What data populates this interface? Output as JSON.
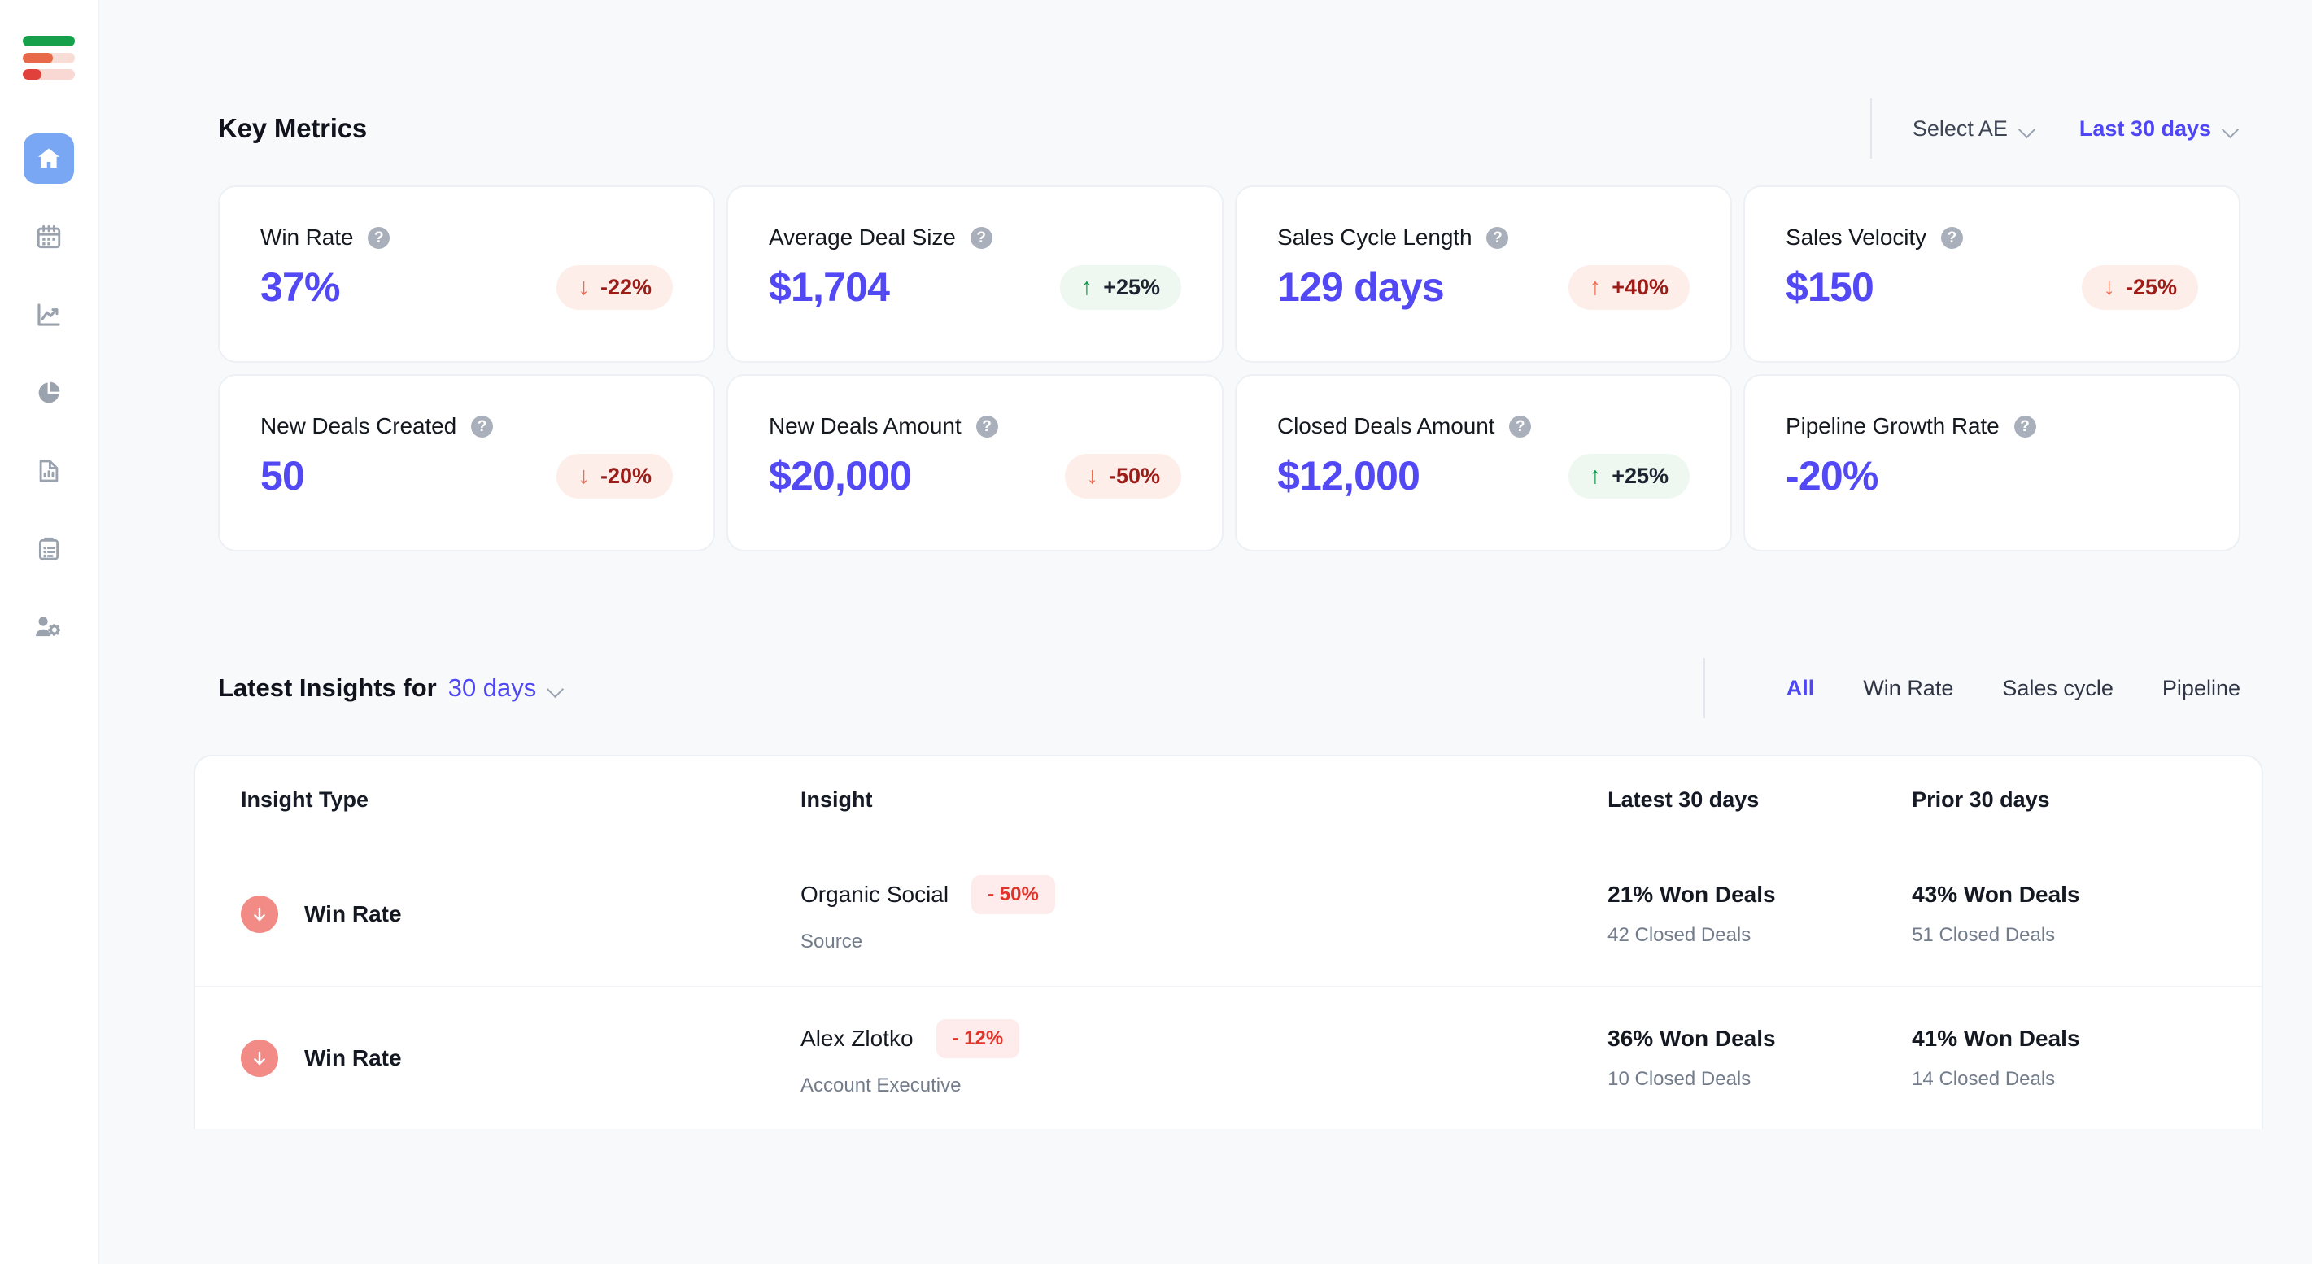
{
  "sidebar": {
    "logo_name": "analytics-logo",
    "items": [
      {
        "icon": "home-icon",
        "label": "Home",
        "active": true
      },
      {
        "icon": "calendar-icon",
        "label": "Calendar",
        "active": false
      },
      {
        "icon": "trending-up-chart-icon",
        "label": "Trends",
        "active": false
      },
      {
        "icon": "pie-chart-icon",
        "label": "Reports",
        "active": false
      },
      {
        "icon": "document-chart-icon",
        "label": "Documents",
        "active": false
      },
      {
        "icon": "clipboard-list-icon",
        "label": "Tasks",
        "active": false
      },
      {
        "icon": "user-settings-icon",
        "label": "Team Settings",
        "active": false
      }
    ]
  },
  "header": {
    "title": "Key Metrics",
    "ae_filter": "Select AE",
    "date_filter": "Last 30 days"
  },
  "metrics": [
    {
      "label": "Win Rate",
      "value": "37%",
      "trend": "-22%",
      "direction": "down",
      "tone": "bad"
    },
    {
      "label": "Average Deal Size",
      "value": "$1,704",
      "trend": "+25%",
      "direction": "up",
      "tone": "good"
    },
    {
      "label": "Sales Cycle Length",
      "value": "129 days",
      "trend": "+40%",
      "direction": "up",
      "tone": "bad"
    },
    {
      "label": "Sales Velocity",
      "value": "$150",
      "trend": "-25%",
      "direction": "down",
      "tone": "bad"
    },
    {
      "label": "New Deals Created",
      "value": "50",
      "trend": "-20%",
      "direction": "down",
      "tone": "bad"
    },
    {
      "label": "New Deals Amount",
      "value": "$20,000",
      "trend": "-50%",
      "direction": "down",
      "tone": "bad"
    },
    {
      "label": "Closed Deals Amount",
      "value": "$12,000",
      "trend": "+25%",
      "direction": "up",
      "tone": "good"
    },
    {
      "label": "Pipeline Growth Rate",
      "value": "-20%",
      "trend": "",
      "direction": "",
      "tone": "none"
    }
  ],
  "insights": {
    "title_prefix": "Latest Insights for",
    "period": "30 days",
    "tabs": [
      {
        "label": "All",
        "active": true
      },
      {
        "label": "Win Rate",
        "active": false
      },
      {
        "label": "Sales cycle",
        "active": false
      },
      {
        "label": "Pipeline",
        "active": false
      }
    ],
    "columns": {
      "type": "Insight Type",
      "insight": "Insight",
      "latest": "Latest 30 days",
      "prior": "Prior 30 days"
    },
    "rows": [
      {
        "direction": "down",
        "type": "Win Rate",
        "insight_name": "Organic Social",
        "insight_delta": "- 50%",
        "insight_sub": "Source",
        "latest_main": "21% Won Deals",
        "latest_sub": "42 Closed Deals",
        "prior_main": "43% Won Deals",
        "prior_sub": "51 Closed Deals"
      },
      {
        "direction": "down",
        "type": "Win Rate",
        "insight_name": "Alex Zlotko",
        "insight_delta": "- 12%",
        "insight_sub": "Account Executive",
        "latest_main": "36% Won Deals",
        "latest_sub": "10 Closed Deals",
        "prior_main": "41% Won Deals",
        "prior_sub": "14 Closed Deals"
      }
    ]
  },
  "colors": {
    "accent": "#4f46f5",
    "value": "#5248f4",
    "negative_bg": "#fdeeea",
    "negative_text": "#9c1c18",
    "positive_bg": "#eef8f1",
    "arrow_red": "#ef6b4e",
    "arrow_green": "#109a4b",
    "badge_circle": "#f28a85",
    "page_bg": "#f7f9fb"
  }
}
